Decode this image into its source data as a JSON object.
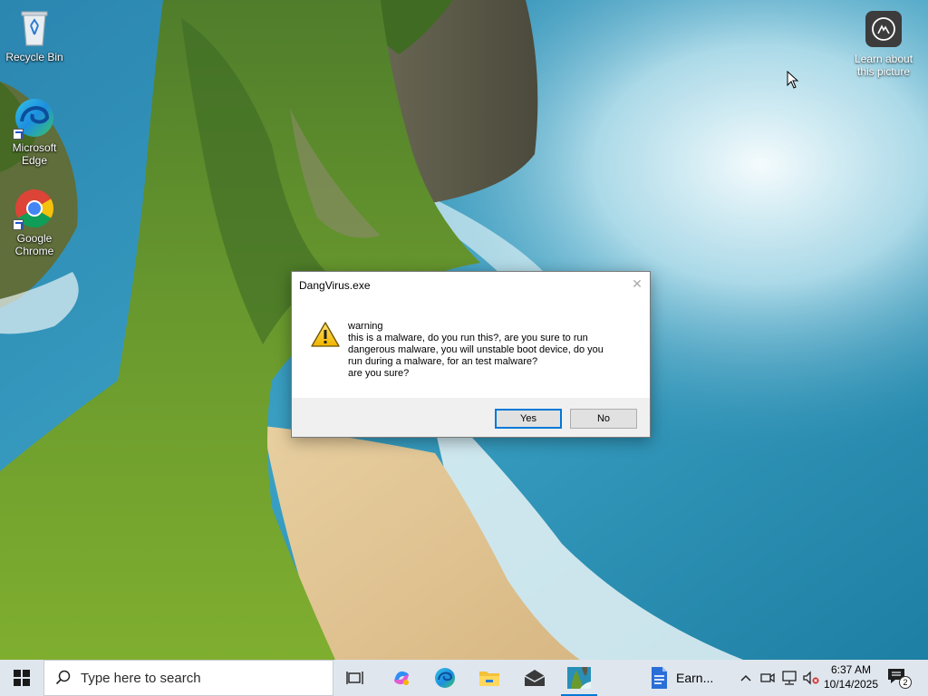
{
  "desktop": {
    "icons": [
      {
        "label": "Recycle Bin",
        "icon": "recycle-bin-icon"
      },
      {
        "label": "Microsoft Edge",
        "icon": "edge-icon"
      },
      {
        "label": "Google Chrome",
        "icon": "chrome-icon"
      }
    ],
    "learn_about_picture": {
      "label": "Learn about this picture",
      "icon": "camera-icon"
    }
  },
  "dialog": {
    "title": "DangVirus.exe",
    "icon": "warning-icon",
    "message": "warning\n this is a malware, do you run this?, are you sure to run\ndangerous malware, you will unstable boot device, do you\nrun during a malware, for an test malware?\n are you sure?",
    "yes_label": "Yes",
    "no_label": "No",
    "close_glyph": "✕"
  },
  "taskbar": {
    "search_placeholder": "Type here to search",
    "pinned": [
      {
        "name": "task-view",
        "icon": "task-view-icon"
      },
      {
        "name": "copilot",
        "icon": "copilot-icon"
      },
      {
        "name": "edge",
        "icon": "edge-icon"
      },
      {
        "name": "file-explorer",
        "icon": "folder-icon"
      },
      {
        "name": "mail",
        "icon": "mail-icon"
      },
      {
        "name": "photo-app",
        "icon": "wallpaper-app-icon",
        "active": true
      }
    ],
    "running_app": {
      "label": "Earn...",
      "icon": "document-icon"
    },
    "tray": {
      "chevron": "^",
      "time": "6:37 AM",
      "date": "10/14/2025",
      "notification_count": "2"
    }
  },
  "colors": {
    "accent": "#0078d7",
    "taskbar_bg": "#dfe6ee",
    "dialog_footer": "#f0f0f0"
  }
}
